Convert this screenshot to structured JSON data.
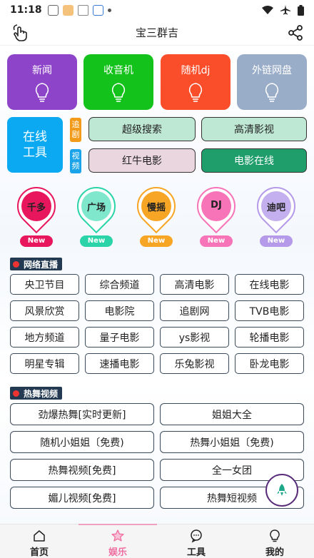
{
  "status": {
    "time": "11:18",
    "icons": [
      "cube-icon",
      "avatar-icon",
      "news-icon",
      "app-icon"
    ],
    "right_icons": [
      "wifi-icon",
      "airplane-icon",
      "battery-icon"
    ]
  },
  "header": {
    "title": "宝三群吉"
  },
  "tiles": [
    {
      "label": "新闻",
      "color": "#8e44c8"
    },
    {
      "label": "收音机",
      "color": "#13c31b"
    },
    {
      "label": "随机dj",
      "color": "#fa4e2a"
    },
    {
      "label": "外链网盘",
      "color": "#9aadc8"
    }
  ],
  "tool": {
    "line1": "在线",
    "line2": "工具"
  },
  "tags": [
    {
      "text": "追剧",
      "color": "#f29b1a"
    },
    {
      "text": "视频",
      "color": "#1aa3e8"
    }
  ],
  "quick": [
    {
      "label": "超级搜索",
      "bg": "#bfe8d4"
    },
    {
      "label": "高清影视",
      "bg": "#bfe8d4"
    },
    {
      "label": "红牛电影",
      "bg": "#ead6df"
    },
    {
      "label": "电影在线",
      "bg": "#1f9e6c"
    }
  ],
  "pins": [
    {
      "label": "千多",
      "badge": "New",
      "color": "#e8175d"
    },
    {
      "label": "广场",
      "badge": "New",
      "color": "#2bd4a8"
    },
    {
      "label": "慢摇",
      "badge": "New",
      "color": "#f7a525"
    },
    {
      "label": "DJ",
      "badge": "New",
      "color": "#f774b8"
    },
    {
      "label": "迪吧",
      "badge": "New",
      "color": "#b49ae8"
    }
  ],
  "section1": {
    "title": "网络直播"
  },
  "grid": [
    "央卫节目",
    "综合频道",
    "高清电影",
    "在线电影",
    "风景欣赏",
    "电影院",
    "追剧网",
    "TVB电影",
    "地方频道",
    "量子电影",
    "ys影视",
    "轮播电影",
    "明星专辑",
    "速播电影",
    "乐兔影视",
    "卧龙电影"
  ],
  "section2": {
    "title": "热舞视频"
  },
  "wide": [
    "劲爆热舞[实时更新]",
    "姐姐大全",
    "随机小姐姐〔免费)",
    "热舞小姐姐〔免费)",
    "热舞视频[免费]",
    "全一女团",
    "媚儿视频[免费]",
    "热舞短视频"
  ],
  "tabs": [
    {
      "label": "首页",
      "icon": "home-icon"
    },
    {
      "label": "娱乐",
      "icon": "star-icon",
      "active": true
    },
    {
      "label": "工具",
      "icon": "chat-icon"
    },
    {
      "label": "我的",
      "icon": "bulb-icon"
    }
  ]
}
